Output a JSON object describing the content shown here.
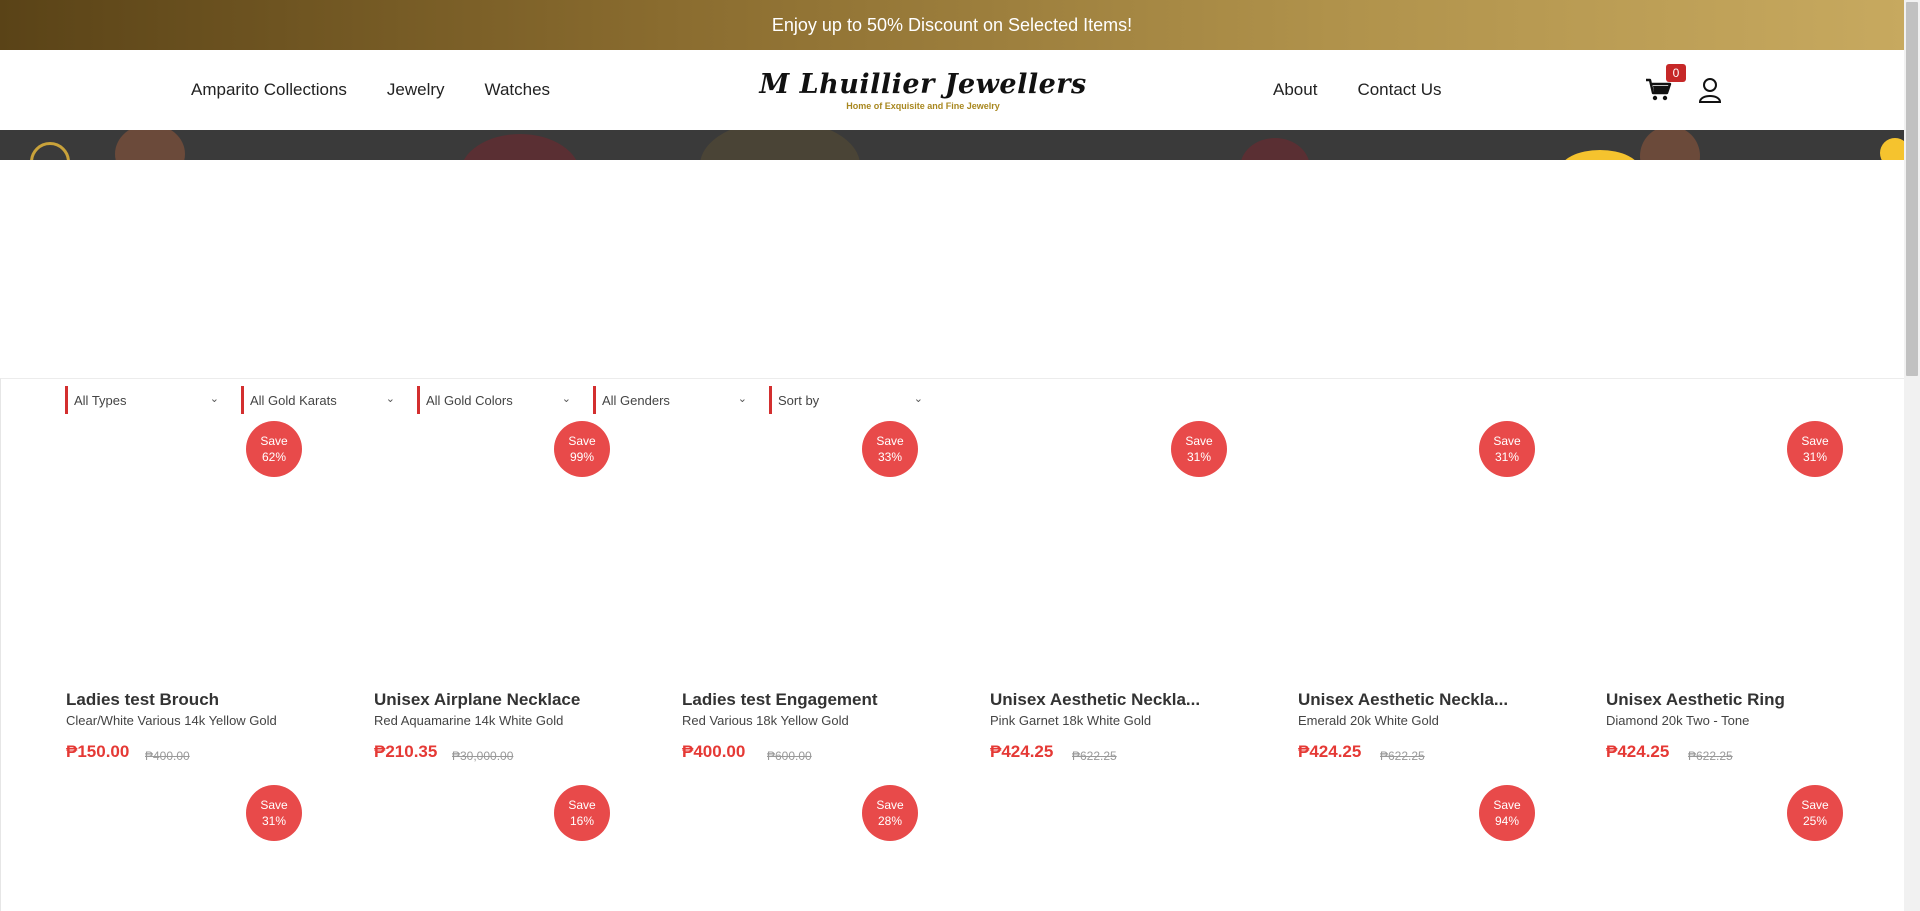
{
  "promo": {
    "text": "Enjoy up to 50% Discount on Selected Items!"
  },
  "nav": {
    "left": [
      "Amparito Collections",
      "Jewelry",
      "Watches"
    ],
    "right": [
      "About",
      "Contact Us"
    ]
  },
  "logo": {
    "name": "M Lhuillier Jewellers",
    "tagline": "Home of Exquisite and Fine Jewelry"
  },
  "cart": {
    "count": "0"
  },
  "filters": [
    "All Types",
    "All Gold Karats",
    "All Gold Colors",
    "All Genders",
    "Sort by"
  ],
  "products": [
    {
      "badge": [
        "Save",
        "62%"
      ],
      "name": "Ladies test Brouch",
      "desc": "Clear/White Various 14k Yellow Gold",
      "price": "₱150.00",
      "old": "₱400.00"
    },
    {
      "badge": [
        "Save",
        "99%"
      ],
      "name": "Unisex Airplane Necklace",
      "desc": "Red Aquamarine 14k White Gold",
      "price": "₱210.35",
      "old": "₱30,000.00"
    },
    {
      "badge": [
        "Save",
        "33%"
      ],
      "name": "Ladies test Engagement",
      "desc": "Red Various 18k Yellow Gold",
      "price": "₱400.00",
      "old": "₱600.00"
    },
    {
      "badge": [
        "Save",
        "31%"
      ],
      "name": "Unisex Aesthetic Neckla...",
      "desc": "Pink Garnet 18k White Gold",
      "price": "₱424.25",
      "old": "₱622.25"
    },
    {
      "badge": [
        "Save",
        "31%"
      ],
      "name": "Unisex Aesthetic Neckla...",
      "desc": "Emerald 20k White Gold",
      "price": "₱424.25",
      "old": "₱622.25"
    },
    {
      "badge": [
        "Save",
        "31%"
      ],
      "name": "Unisex Aesthetic Ring",
      "desc": "Diamond 20k Two - Tone",
      "price": "₱424.25",
      "old": "₱622.25"
    }
  ],
  "row2_badges": [
    [
      "Save",
      "31%"
    ],
    [
      "Save",
      "16%"
    ],
    [
      "Save",
      "28%"
    ],
    null,
    [
      "Save",
      "94%"
    ],
    [
      "Save",
      "25%"
    ]
  ],
  "colors": {
    "accent_red": "#e84a4a",
    "price_red": "#e53935",
    "gold": "#a8871f"
  }
}
